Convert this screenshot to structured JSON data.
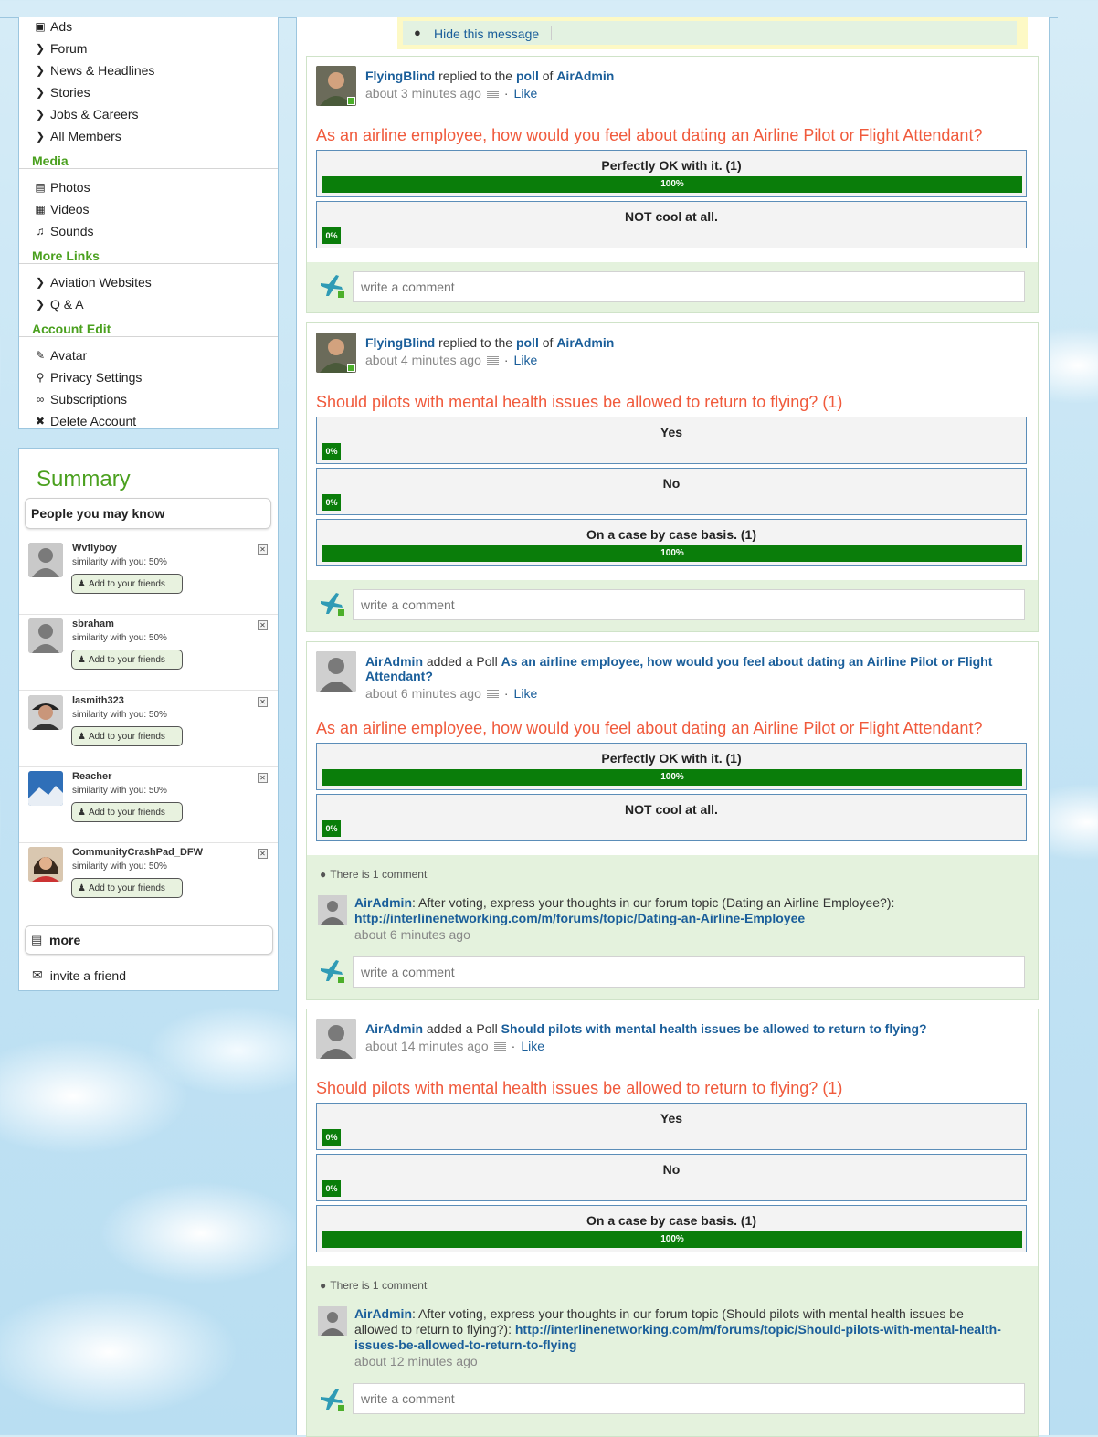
{
  "sidebar": {
    "nav": [
      {
        "label": "Ads",
        "icon": "ads-icon"
      },
      {
        "label": "Forum",
        "icon": "chevron-right-icon"
      },
      {
        "label": "News & Headlines",
        "icon": "chevron-right-icon"
      },
      {
        "label": "Stories",
        "icon": "chevron-right-icon"
      },
      {
        "label": "Jobs & Careers",
        "icon": "chevron-right-icon"
      },
      {
        "label": "All Members",
        "icon": "chevron-right-icon"
      }
    ],
    "media_heading": "Media",
    "media": [
      {
        "label": "Photos",
        "icon": "photo-icon"
      },
      {
        "label": "Videos",
        "icon": "film-icon"
      },
      {
        "label": "Sounds",
        "icon": "music-note-icon"
      }
    ],
    "more_links_heading": "More Links",
    "more_links": [
      {
        "label": "Aviation Websites",
        "icon": "chevron-right-icon"
      },
      {
        "label": "Q & A",
        "icon": "chevron-right-icon"
      }
    ],
    "account_heading": "Account Edit",
    "account": [
      {
        "label": "Avatar",
        "icon": "edit-icon"
      },
      {
        "label": "Privacy Settings",
        "icon": "key-icon"
      },
      {
        "label": "Subscriptions",
        "icon": "paperclip-icon"
      },
      {
        "label": "Delete Account",
        "icon": "x-icon"
      }
    ]
  },
  "summary": {
    "title": "Summary",
    "people_heading": "People you may know",
    "add_label": "Add to your friends",
    "people": [
      {
        "name": "Wvflyboy",
        "similarity": "similarity with you: 50%"
      },
      {
        "name": "sbraham",
        "similarity": "similarity with you: 50%"
      },
      {
        "name": "lasmith323",
        "similarity": "similarity with you: 50%"
      },
      {
        "name": "Reacher",
        "similarity": "similarity with you: 50%"
      },
      {
        "name": "CommunityCrashPad_DFW",
        "similarity": "similarity with you: 50%"
      }
    ],
    "more_label": "more",
    "invite_label": "invite a friend"
  },
  "message": {
    "hide_label": "Hide this message"
  },
  "common": {
    "replied_text": " replied to the ",
    "poll_word": "poll",
    "of_word": " of ",
    "added_poll": " added a Poll ",
    "like": "Like",
    "dot": "·",
    "comment_placeholder": "write a comment",
    "comment_count": "There is 1 comment"
  },
  "feed": [
    {
      "author": "FlyingBlind",
      "target": "AirAdmin",
      "time": "about 3 minutes ago",
      "question": "As an airline employee, how would you feel about dating an Airline Pilot or Flight Attendant?",
      "options": [
        {
          "label": "Perfectly OK with it. (1)",
          "percent": 100,
          "percent_label": "100%"
        },
        {
          "label": "NOT cool at all.",
          "percent": 0,
          "percent_label": "0%"
        }
      ]
    },
    {
      "author": "FlyingBlind",
      "target": "AirAdmin",
      "time": "about 4 minutes ago",
      "question": "Should pilots with mental health issues be allowed to return to flying? (1)",
      "options": [
        {
          "label": "Yes",
          "percent": 0,
          "percent_label": "0%"
        },
        {
          "label": "No",
          "percent": 0,
          "percent_label": "0%"
        },
        {
          "label": "On a case by case basis. (1)",
          "percent": 100,
          "percent_label": "100%"
        }
      ]
    },
    {
      "author": "AirAdmin",
      "poll_link": "As an airline employee, how would you feel about dating an Airline Pilot or Flight Attendant?",
      "time": "about 6 minutes ago",
      "question": "As an airline employee, how would you feel about dating an Airline Pilot or Flight Attendant?",
      "options": [
        {
          "label": "Perfectly OK with it. (1)",
          "percent": 100,
          "percent_label": "100%"
        },
        {
          "label": "NOT cool at all.",
          "percent": 0,
          "percent_label": "0%"
        }
      ],
      "comment": {
        "author": "AirAdmin",
        "text": ": After voting, express your thoughts in our forum topic (Dating an Airline Employee?): ",
        "url": "http://interlinenetworking.com/m/forums/topic/Dating-an-Airline-Employee",
        "time": "about 6 minutes ago"
      }
    },
    {
      "author": "AirAdmin",
      "poll_link": "Should pilots with mental health issues be allowed to return to flying?",
      "time": "about 14 minutes ago",
      "question": "Should pilots with mental health issues be allowed to return to flying? (1)",
      "options": [
        {
          "label": "Yes",
          "percent": 0,
          "percent_label": "0%"
        },
        {
          "label": "No",
          "percent": 0,
          "percent_label": "0%"
        },
        {
          "label": "On a case by case basis. (1)",
          "percent": 100,
          "percent_label": "100%"
        }
      ],
      "comment": {
        "author": "AirAdmin",
        "text": ": After voting, express your thoughts in our forum topic (Should pilots with mental health issues be allowed to return to flying?): ",
        "url": "http://interlinenetworking.com/m/forums/topic/Should-pilots-with-mental-health-issues-be-allowed-to-return-to-flying",
        "time": "about 12 minutes ago"
      }
    }
  ],
  "colors": {
    "accent_green": "#4aa01e",
    "link_blue": "#1a5e9a",
    "question_red": "#f05a3c",
    "bar_green": "#0a7d0a"
  }
}
